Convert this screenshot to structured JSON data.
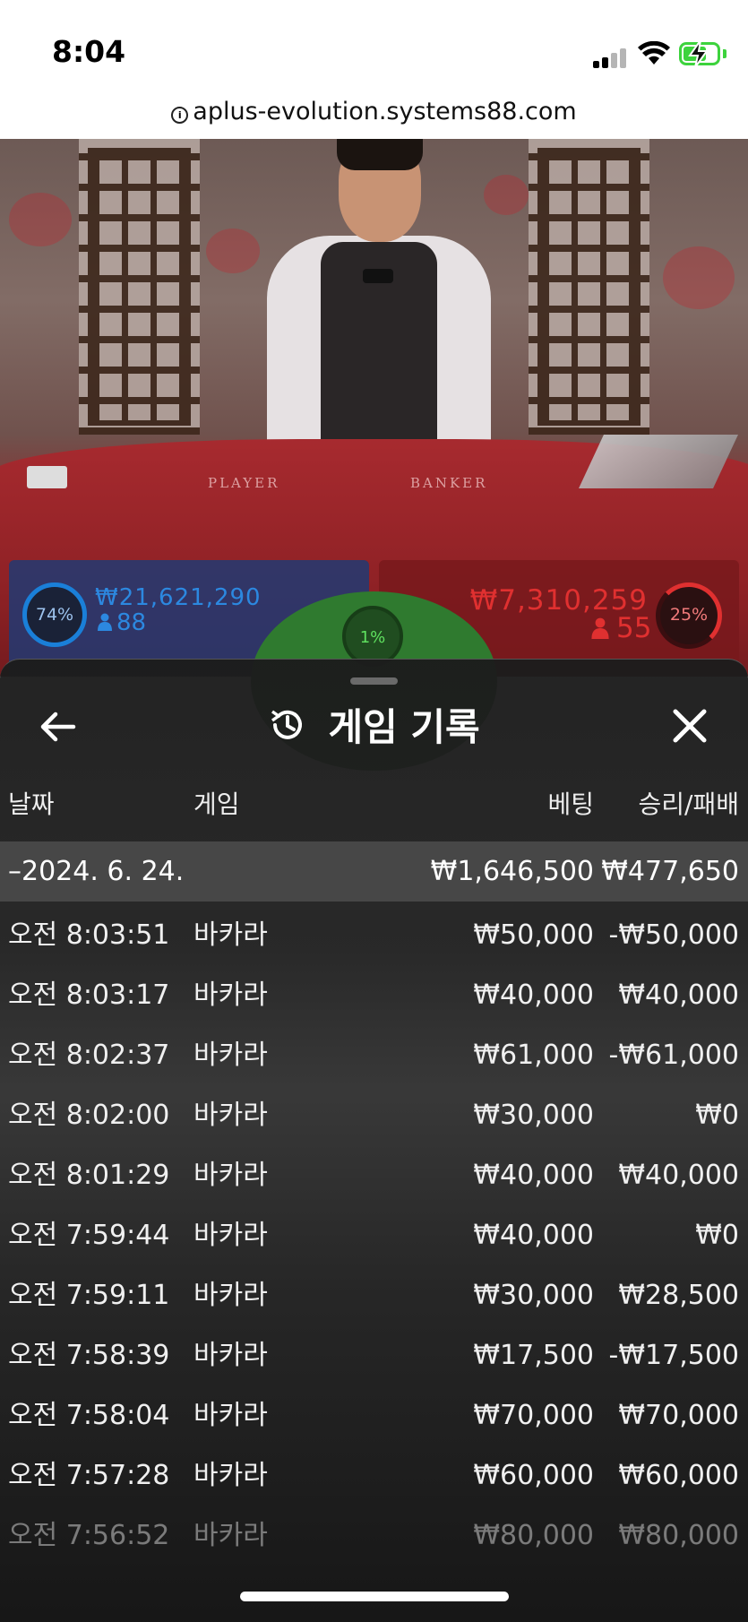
{
  "status_bar": {
    "time": "8:04"
  },
  "browser": {
    "url": "aplus-evolution.systems88.com"
  },
  "video": {
    "felt_player_label": "PLAYER",
    "felt_banker_label": "BANKER"
  },
  "bets": {
    "player": {
      "percent": "74%",
      "amount": "₩21,621,290",
      "count": "88",
      "color": "#2c88e0"
    },
    "tie": {
      "percent": "1%",
      "color": "#5fe05f"
    },
    "banker": {
      "percent": "25%",
      "amount": "₩7,310,259",
      "count": "55",
      "color": "#e03030"
    }
  },
  "sheet": {
    "title": "게임 기록",
    "icons": {
      "back": "arrow-left-icon",
      "history": "history-icon",
      "close": "close-icon"
    },
    "columns": {
      "date": "날짜",
      "game": "게임",
      "bet": "베팅",
      "result": "승리/패배"
    },
    "date_group": {
      "label": "–2024. 6. 24.",
      "total_bet": "₩1,646,500",
      "total_result": "₩477,650"
    },
    "rows": [
      {
        "time": "오전 8:03:51",
        "game": "바카라",
        "bet": "₩50,000",
        "result": "-₩50,000"
      },
      {
        "time": "오전 8:03:17",
        "game": "바카라",
        "bet": "₩40,000",
        "result": "₩40,000"
      },
      {
        "time": "오전 8:02:37",
        "game": "바카라",
        "bet": "₩61,000",
        "result": "-₩61,000"
      },
      {
        "time": "오전 8:02:00",
        "game": "바카라",
        "bet": "₩30,000",
        "result": "₩0"
      },
      {
        "time": "오전 8:01:29",
        "game": "바카라",
        "bet": "₩40,000",
        "result": "₩40,000"
      },
      {
        "time": "오전 7:59:44",
        "game": "바카라",
        "bet": "₩40,000",
        "result": "₩0"
      },
      {
        "time": "오전 7:59:11",
        "game": "바카라",
        "bet": "₩30,000",
        "result": "₩28,500"
      },
      {
        "time": "오전 7:58:39",
        "game": "바카라",
        "bet": "₩17,500",
        "result": "-₩17,500"
      },
      {
        "time": "오전 7:58:04",
        "game": "바카라",
        "bet": "₩70,000",
        "result": "₩70,000"
      },
      {
        "time": "오전 7:57:28",
        "game": "바카라",
        "bet": "₩60,000",
        "result": "₩60,000"
      },
      {
        "time": "오전 7:56:52",
        "game": "바카라",
        "bet": "₩80,000",
        "result": "₩80,000"
      }
    ]
  }
}
